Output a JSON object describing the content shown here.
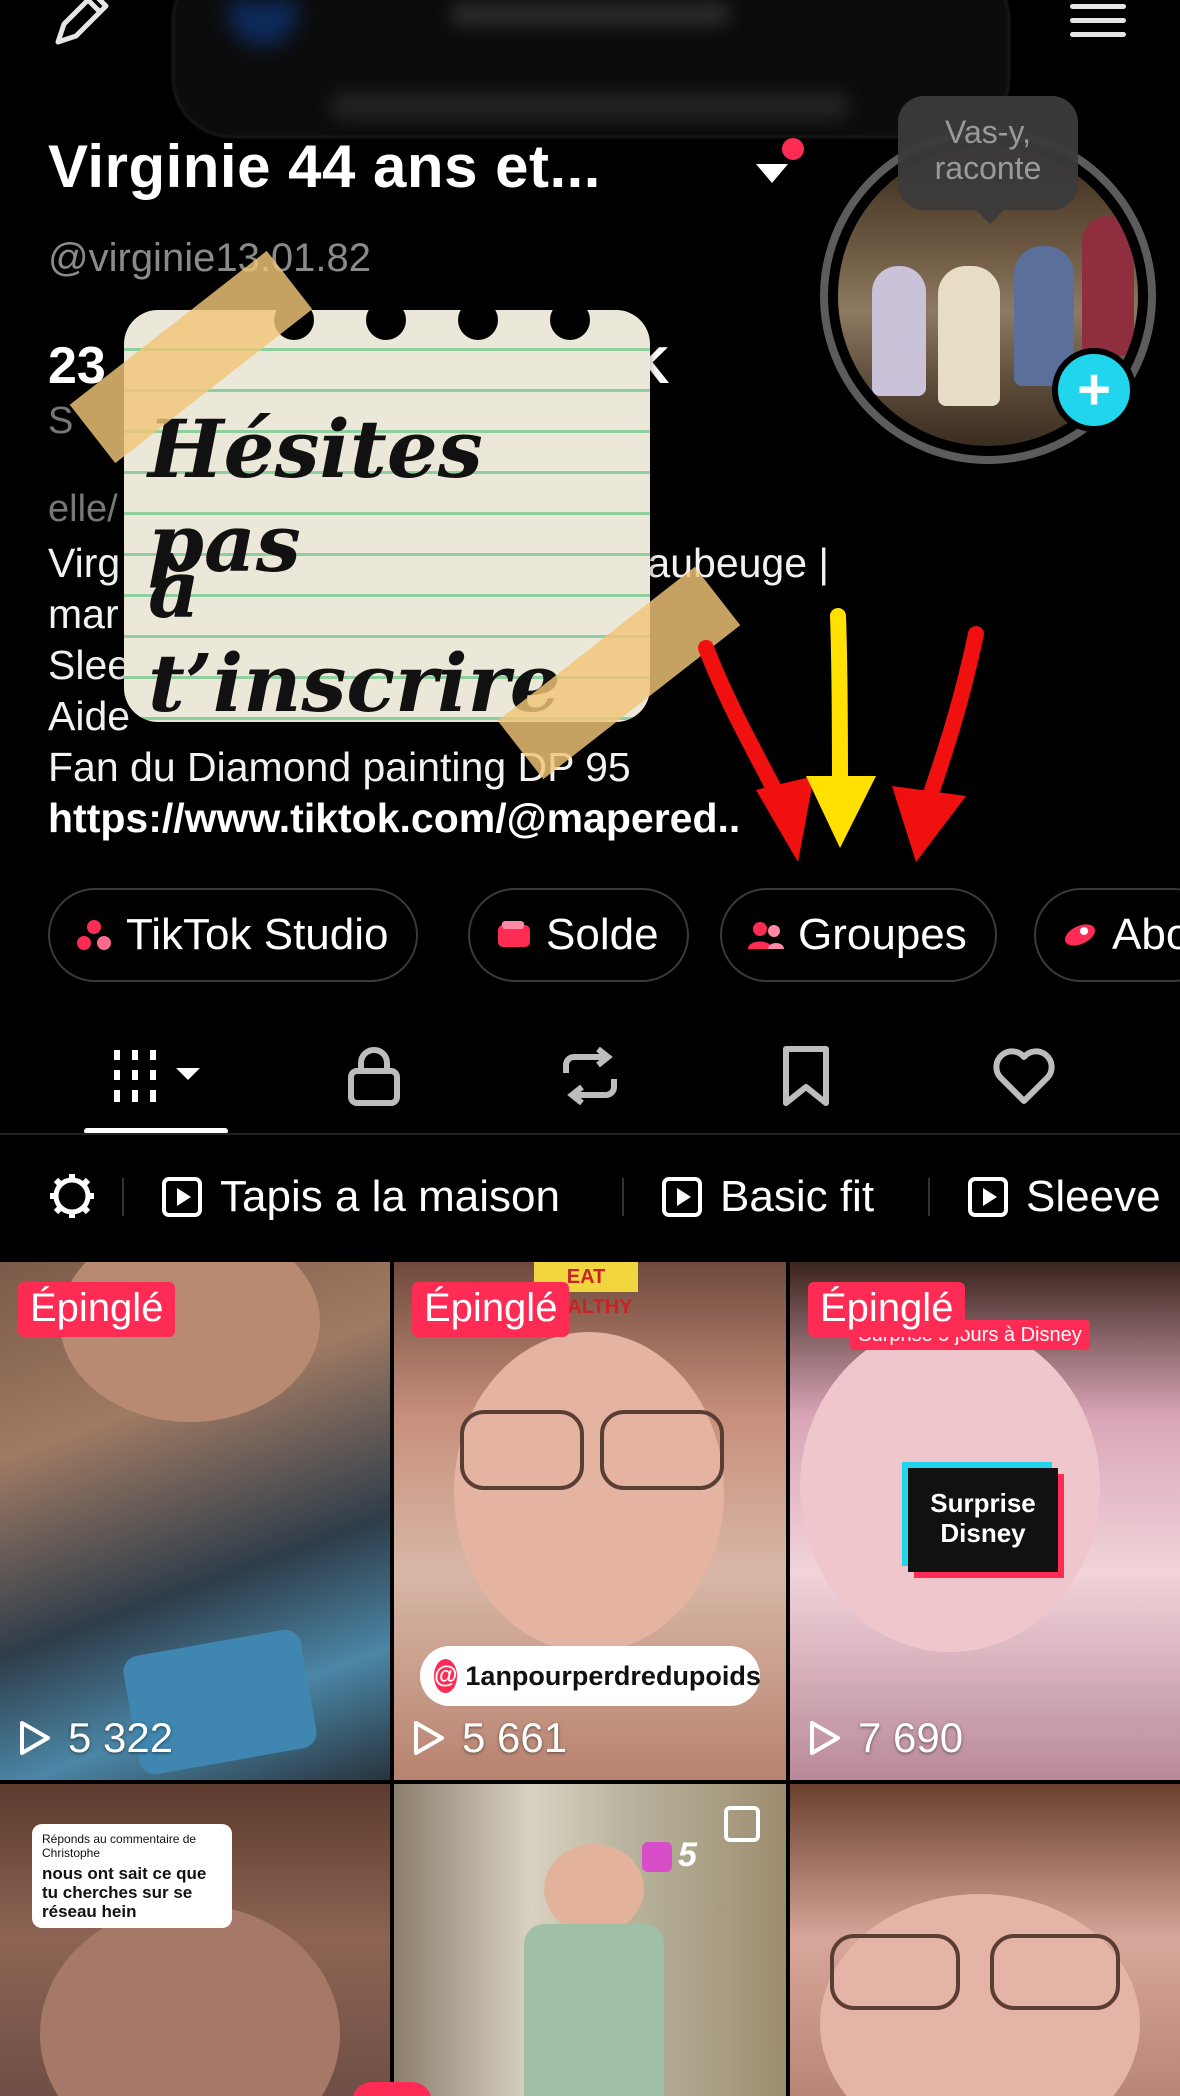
{
  "header": {
    "profile_name": "Virginie 44 ans et...",
    "handle": "@virginie13.01.82",
    "avatar_bubble": "Vas-y,\nraconte"
  },
  "stats": {
    "partial_count": "23",
    "partial_count_suffix": "K",
    "partial_label": "S"
  },
  "bio": {
    "pronoun_partial": "elle/",
    "lines": [
      "Virg                          ans 📍 59 Maubeuge |",
      "mar",
      "Slee",
      "Aide",
      "Fan du Diamond painting DP 95"
    ],
    "link": "https://www.tiktok.com/@mapered.."
  },
  "sticker": {
    "line1": "Hésites pas",
    "line2": "à t’inscrire"
  },
  "chips": [
    {
      "label": "TikTok Studio",
      "icon": "studio-icon"
    },
    {
      "label": "Solde",
      "icon": "wallet-icon"
    },
    {
      "label": "Groupes",
      "icon": "groups-icon"
    },
    {
      "label": "Abo",
      "icon": "subscription-icon"
    }
  ],
  "tabs": [
    "videos-grid-icon",
    "lock-icon",
    "repost-icon",
    "bookmark-icon",
    "heart-icon"
  ],
  "playlists": {
    "items": [
      {
        "label": "Tapis a la maison"
      },
      {
        "label": "Basic fit"
      },
      {
        "label": "Sleeve"
      }
    ]
  },
  "grid": {
    "tiles": [
      {
        "pinned": "Épinglé",
        "views": "5 322"
      },
      {
        "pinned": "Épinglé",
        "views": "5 661",
        "overlay_tag": "1anpourperdredupoids",
        "overlay_top": "EAT HEALTHY"
      },
      {
        "pinned": "Épinglé",
        "views": "7 690",
        "overlay_text": "Surprise\nDisney",
        "caption": "Surprise 5 jours à Disney"
      },
      {
        "reply_header": "Réponds au commentaire de Christophe",
        "reply_text": "nous ont sait ce que tu cherches sur se réseau hein"
      },
      {
        "badge": "5"
      },
      {}
    ]
  },
  "colors": {
    "accent": "#fe2c55",
    "avatar_add": "#20d5ec",
    "arrow_red": "#f01010",
    "arrow_yellow": "#ffe000"
  }
}
